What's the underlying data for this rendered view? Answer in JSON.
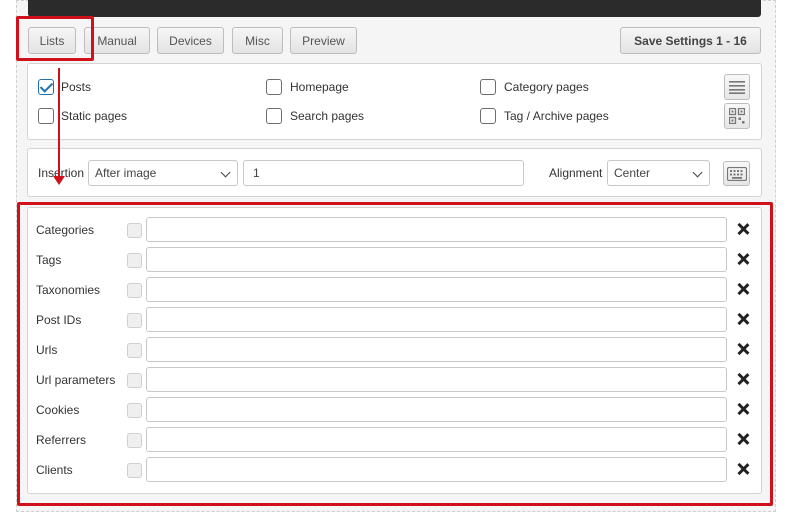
{
  "tabs": [
    {
      "label": "Lists",
      "active": true
    },
    {
      "label": "Manual"
    },
    {
      "label": "Devices"
    },
    {
      "label": "Misc"
    },
    {
      "label": "Preview"
    }
  ],
  "save_button": "Save Settings 1 - 16",
  "page_types": {
    "posts": {
      "label": "Posts",
      "checked": true
    },
    "homepage": {
      "label": "Homepage",
      "checked": false
    },
    "category_pages": {
      "label": "Category pages",
      "checked": false
    },
    "static_pages": {
      "label": "Static pages",
      "checked": false
    },
    "search_pages": {
      "label": "Search pages",
      "checked": false
    },
    "tag_archive_pages": {
      "label": "Tag / Archive pages",
      "checked": false
    }
  },
  "insertion": {
    "label": "Insertion",
    "selected": "After image",
    "value": "1"
  },
  "alignment": {
    "label": "Alignment",
    "selected": "Center"
  },
  "lists": [
    {
      "label": "Categories",
      "value": ""
    },
    {
      "label": "Tags",
      "value": ""
    },
    {
      "label": "Taxonomies",
      "value": ""
    },
    {
      "label": "Post IDs",
      "value": ""
    },
    {
      "label": "Urls",
      "value": ""
    },
    {
      "label": "Url parameters",
      "value": ""
    },
    {
      "label": "Cookies",
      "value": ""
    },
    {
      "label": "Referrers",
      "value": ""
    },
    {
      "label": "Clients",
      "value": ""
    }
  ],
  "colors": {
    "highlight": "#d0111b",
    "accent": "#2271b1"
  },
  "icons": [
    "list-icon",
    "qr-code-icon",
    "keyboard-icon",
    "close-icon",
    "check-icon"
  ]
}
